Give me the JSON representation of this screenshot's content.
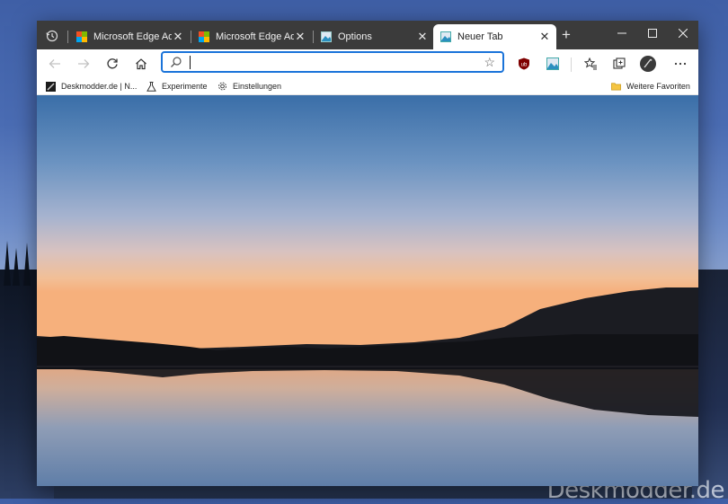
{
  "tabs": [
    {
      "label": "Microsoft Edge Addons",
      "favicon": "microsoft-logo-icon",
      "active": false
    },
    {
      "label": "Microsoft Edge Addons",
      "favicon": "microsoft-logo-icon",
      "active": false
    },
    {
      "label": "Options",
      "favicon": "image-icon",
      "active": false
    },
    {
      "label": "Neuer Tab",
      "favicon": "image-icon",
      "active": true
    }
  ],
  "address": {
    "value": "",
    "placeholder": ""
  },
  "favorites": {
    "items": [
      {
        "label": "Deskmodder.de | N...",
        "icon": "site-favicon-icon"
      },
      {
        "label": "Experimente",
        "icon": "flask-icon"
      },
      {
        "label": "Einstellungen",
        "icon": "gear-icon"
      }
    ],
    "other_label": "Weitere Favoriten"
  },
  "watermark": "Deskmodder.de",
  "colors": {
    "accent": "#1a73d9",
    "tabbar": "#3b3b3b"
  }
}
